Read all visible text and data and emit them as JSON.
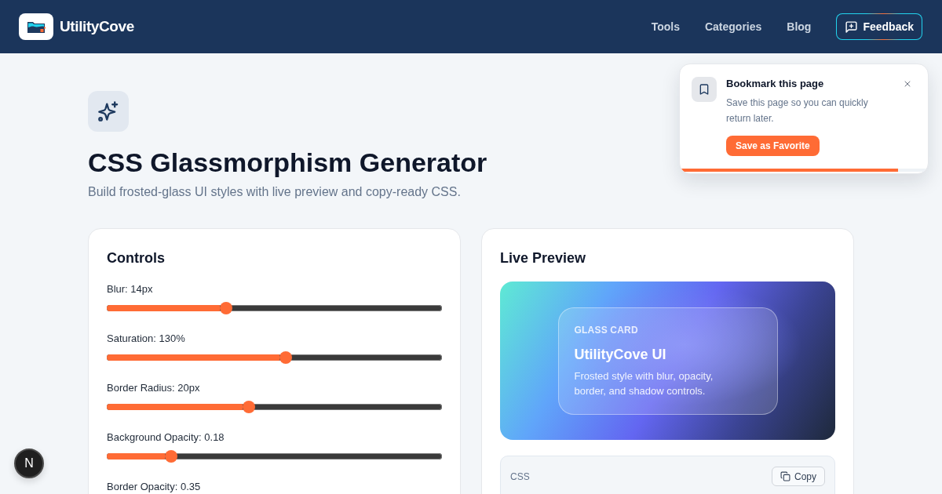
{
  "header": {
    "brand": "UtilityCove",
    "nav": [
      "Tools",
      "Categories",
      "Blog"
    ],
    "feedback_button": "Feedback"
  },
  "toast": {
    "title": "Bookmark this page",
    "message": "Save this page so you can quickly return later.",
    "button": "Save as Favorite",
    "progress": {
      "level": 0.88
    }
  },
  "hero": {
    "title": "CSS Glassmorphism Generator",
    "subtitle": "Build frosted-glass UI styles with live preview and copy-ready CSS."
  },
  "controls": {
    "title": "Controls",
    "sliders": [
      {
        "label": "Blur: 14px",
        "level": 0.35
      },
      {
        "label": "Saturation: 130%",
        "level": 0.535
      },
      {
        "label": "Border Radius: 20px",
        "level": 0.42
      },
      {
        "label": "Background Opacity: 0.18",
        "level": 0.18
      },
      {
        "label": "Border Opacity: 0.35"
      }
    ]
  },
  "preview": {
    "title": "Live Preview",
    "glass_card": {
      "eyebrow": "GLASS CARD",
      "title": "UtilityCove UI",
      "text": "Frosted style with blur, opacity, border, and shadow controls."
    }
  },
  "css_output": {
    "label": "CSS",
    "copy_button": "Copy"
  },
  "dev_badge": {
    "label": "N"
  }
}
